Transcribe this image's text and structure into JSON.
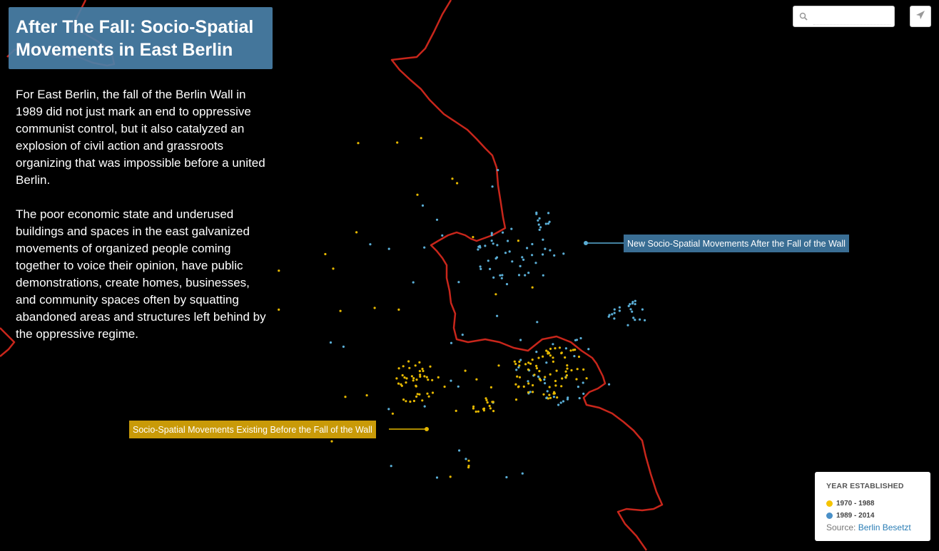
{
  "title": "After The Fall: Socio-Spatial Movements in East Berlin",
  "intro": {
    "p1": "For East Berlin, the fall of the Berlin Wall in 1989 did not just mark an end to oppressive communist control, but it also catalyzed an explosion of civil action and grassroots organizing that was impossible before a united Berlin.",
    "p2": "The poor economic state and underused buildings and spaces in the east galvanized movements of organized people coming together to voice their opinion, have public demonstrations, create homes, businesses, and community spaces often by squatting abandoned areas and structures left behind by the oppressive regime."
  },
  "search": {
    "placeholder": "",
    "value": "",
    "icon": "search-icon"
  },
  "share": {
    "icon": "share-icon"
  },
  "callouts": {
    "after": "New Socio-Spatial Movements After the Fall of the Wall",
    "before": "Socio-Spatial Movements Existing Before the Fall of the Wall"
  },
  "legend": {
    "title": "YEAR ESTABLISHED",
    "items": [
      {
        "label": "1970 - 1988",
        "color": "#f5c400"
      },
      {
        "label": "1989 - 2014",
        "color": "#4a90c8"
      }
    ],
    "source_prefix": "Source:",
    "source_link": "Berlin Besetzt"
  },
  "colors": {
    "background": "#000000",
    "wall": "#c8261b",
    "before_points": "#e6b800",
    "after_points": "#5aaed6",
    "title_box": "#4a80a8"
  }
}
